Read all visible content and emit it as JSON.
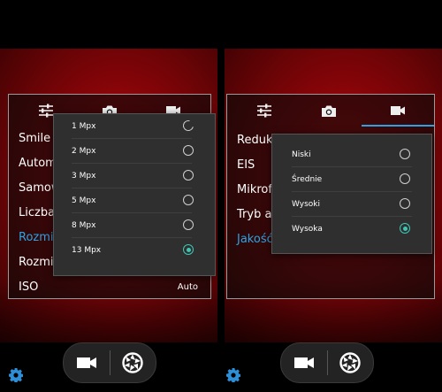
{
  "colors": {
    "accent": "#2ea3e3",
    "radio_selected": "#3fc6b3",
    "settings_icon": "#2e8fd6",
    "viewfinder_red": "#9c0608"
  },
  "left_screen": {
    "tabs": [
      {
        "icon": "sliders-icon"
      },
      {
        "icon": "camera-icon"
      },
      {
        "icon": "video-icon"
      }
    ],
    "settings": [
      {
        "label": "Smile s"
      },
      {
        "label": "Automa"
      },
      {
        "label": "Samow"
      },
      {
        "label": "Liczba"
      },
      {
        "label": "Rozmia"
      },
      {
        "label": "Rozmia"
      },
      {
        "label": "ISO",
        "value": "Auto"
      }
    ],
    "popup": {
      "options": [
        {
          "label": "1 Mpx",
          "selected": false
        },
        {
          "label": "2 Mpx",
          "selected": false
        },
        {
          "label": "3 Mpx",
          "selected": false
        },
        {
          "label": "5 Mpx",
          "selected": false
        },
        {
          "label": "8 Mpx",
          "selected": false
        },
        {
          "label": "13 Mpx",
          "selected": true
        }
      ]
    }
  },
  "right_screen": {
    "tabs": [
      {
        "icon": "sliders-icon"
      },
      {
        "icon": "camera-icon"
      },
      {
        "icon": "video-icon"
      }
    ],
    "settings": [
      {
        "label": "Reduko"
      },
      {
        "label": "EIS"
      },
      {
        "label": "Mikrofo"
      },
      {
        "label": "Tryb au"
      },
      {
        "label": "Jakość"
      }
    ],
    "popup": {
      "options": [
        {
          "label": "Niski",
          "selected": false
        },
        {
          "label": "Średnie",
          "selected": false
        },
        {
          "label": "Wysoki",
          "selected": false
        },
        {
          "label": "Wysoka",
          "selected": true
        }
      ]
    }
  },
  "bottom_controls": {
    "mode_icons": [
      "video-camera-icon",
      "shutter-icon"
    ],
    "settings_icon": "gear-icon"
  }
}
